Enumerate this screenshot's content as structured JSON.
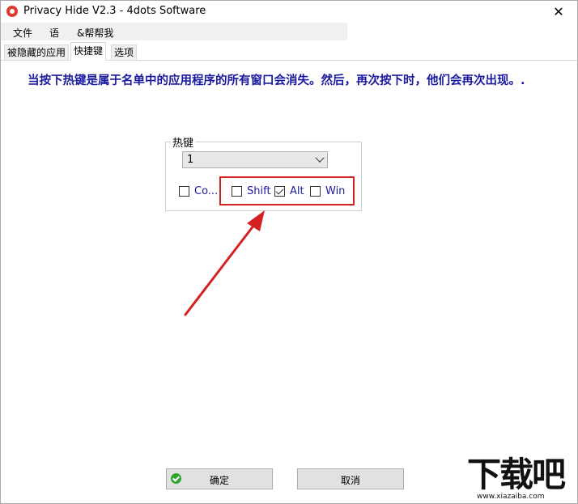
{
  "window": {
    "title": "Privacy Hide V2.3 - 4dots Software",
    "close_glyph": "✕"
  },
  "menu": {
    "items": [
      "文件",
      "语",
      "&帮帮我"
    ]
  },
  "tabs": [
    {
      "label": "被隐藏的应用",
      "active": false
    },
    {
      "label": "快捷键",
      "active": true
    },
    {
      "label": "选项",
      "active": false
    }
  ],
  "instruction": "当按下热键是属于名单中的应用程序的所有窗口会消失。然后，再次按下时，他们会再次出现。.",
  "hotkey": {
    "group_label": "热键",
    "selected_value": "1",
    "modifiers": [
      {
        "label": "Co...",
        "checked": false
      },
      {
        "label": "Shift",
        "checked": false
      },
      {
        "label": "Alt",
        "checked": true
      },
      {
        "label": "Win",
        "checked": false
      }
    ]
  },
  "buttons": {
    "ok_label": "确定",
    "cancel_label": "取消"
  },
  "watermark": {
    "text": "下载吧",
    "url": "www.xiazaiba.com"
  },
  "colors": {
    "instruction_text": "#1a1aa0",
    "highlight": "#d42020",
    "ok_icon": "#2fa52f"
  },
  "icons": {
    "app": "privacy-hide-app-icon",
    "ok": "check-circle-icon"
  }
}
